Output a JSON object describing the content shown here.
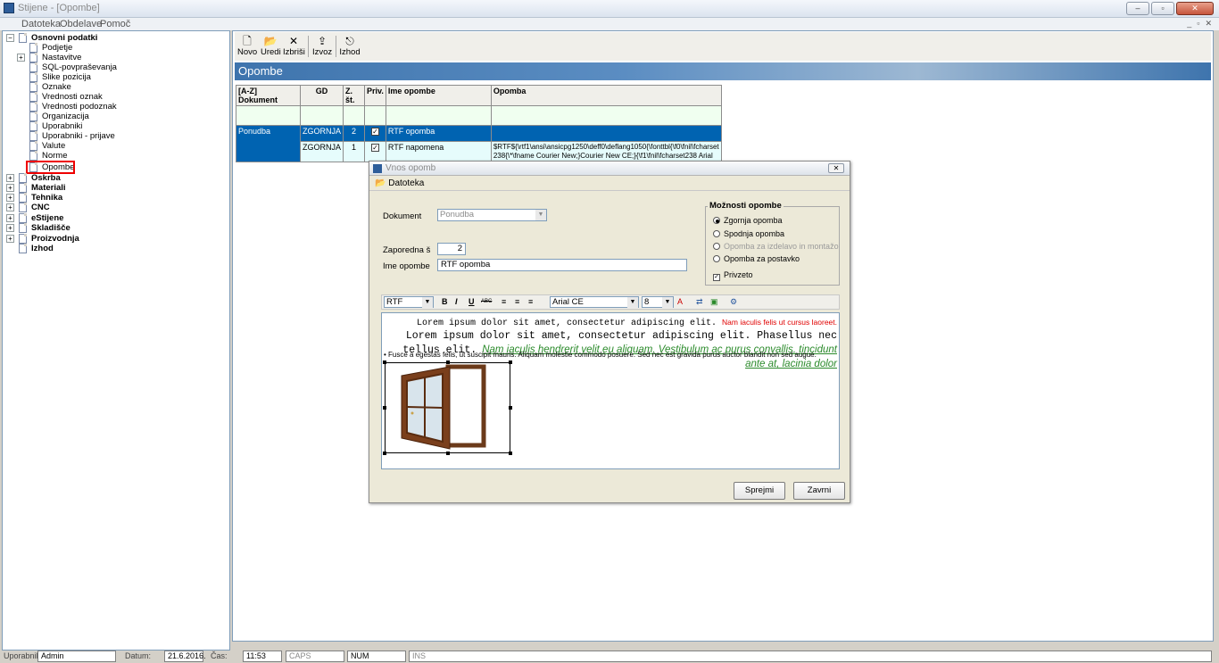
{
  "window": {
    "title": "Stijene - [Opombe]",
    "controls": [
      "–",
      "▫",
      "✕"
    ],
    "mdi_controls": [
      "_",
      "▫",
      "✕"
    ]
  },
  "menu": [
    "Datoteka",
    "Obdelave",
    "Pomoč"
  ],
  "tree": {
    "root": "Osnovni podatki",
    "children": [
      "Podjetje",
      "Nastavitve",
      "SQL-povpraševanja",
      "Slike pozicija",
      "Oznake",
      "Vrednosti oznak",
      "Vrednosti podoznak",
      "Organizacija",
      "Uporabniki",
      "Uporabniki - prijave",
      "Valute",
      "Norme",
      "Opombe"
    ],
    "groups": [
      "Oskrba",
      "Materiali",
      "Tehnika",
      "CNC",
      "eStijene",
      "Skladišče",
      "Proizvodnja",
      "Izhod"
    ],
    "selected": "Opombe"
  },
  "toolbar": {
    "new": "Novo",
    "edit": "Uredi",
    "delete": "Izbriši",
    "export": "Izvoz",
    "exit": "Izhod"
  },
  "banner": "Opombe",
  "grid": {
    "headers": [
      "[A-Z] Dokument",
      "GD",
      "Z. št.",
      "Priv.",
      "Ime opombe",
      "Opomba"
    ],
    "rows": [
      {
        "doc": "Ponudba",
        "gd": "ZGORNJA",
        "z": "2",
        "priv": "✓",
        "name": "RTF opomba",
        "note": ""
      },
      {
        "doc": "",
        "gd": "ZGORNJA",
        "z": "1",
        "priv": "✓",
        "name": "RTF napomena",
        "note": "$RTF${\\rtf1\\ansi\\ansicpg1250\\deff0\\deflang1050{\\fonttbl{\\f0\\fnil\\fcharset 238{\\*\\fname Courier New;}Courier New CE;}{\\f1\\fnil\\fcharset238 Arial"
      }
    ]
  },
  "dialog": {
    "title": "Vnos opomb",
    "menu": "Datoteka",
    "document_label": "Dokument",
    "document_value": "Ponudba",
    "seq_label": "Zaporedna š",
    "seq_value": "2",
    "name_label": "Ime opombe",
    "name_value": "RTF opomba",
    "options_title": "Možnosti opombe",
    "options": [
      "Zgornja opomba",
      "Spodnja opomba",
      "Opomba za izdelavo in montažo",
      "Opomba za postavko"
    ],
    "private_label": "Privzeto",
    "format": {
      "style": "RTF",
      "font": "Arial CE",
      "size": "8",
      "bold": "B",
      "italic": "I",
      "underline": "U",
      "strike": "ABC"
    },
    "editor": {
      "line1_mono": "Lorem ipsum dolor sit amet, consectetur adipiscing elit.",
      "line1_red": "Nam iaculis felis ut cursus laoreet.",
      "line1_big": "Lorem ipsum dolor sit amet, consectetur adipiscing elit. Phasellus nec tellus elit.",
      "line1_green": "Nam iaculis hendrerit velit eu aliquam. Vestibulum ac purus convallis, tincidunt ante at, lacinia dolor",
      "bullet": "• Fusce a egestas felis, ut suscipit mauris. Aliquam molestie commodo posuere. Sed nec est gravida purus auctor blandit non sed augue."
    },
    "accept": "Sprejmi",
    "close": "Zavrni"
  },
  "status": {
    "user_label": "Uporabnik:",
    "user": "Admin",
    "date_label": "Datum:",
    "date": "21.6.2016.",
    "time_label": "Čas:",
    "time": "11:53",
    "caps": "CAPS",
    "num": "NUM",
    "ins": "INS"
  }
}
